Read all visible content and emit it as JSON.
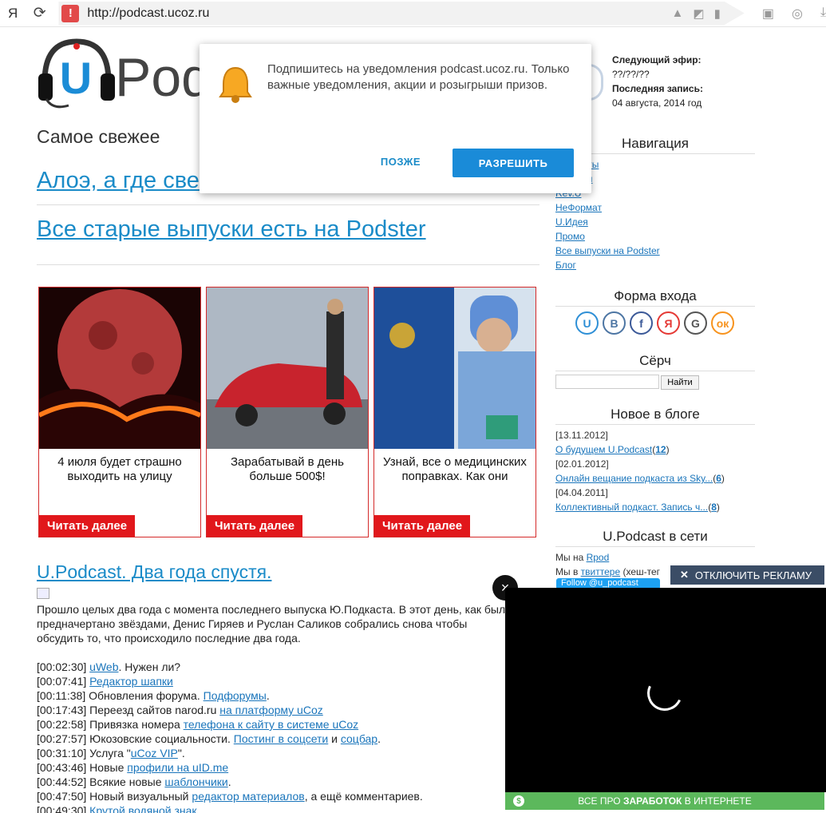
{
  "browser": {
    "logo": "Я",
    "url": "http://podcast.ucoz.ru",
    "warning_icon": "warning-icon",
    "reload_icon": "reload-icon",
    "badge_count": "1"
  },
  "site": {
    "logo_letter": "U",
    "logo_text": "Podc"
  },
  "header_info": {
    "next_label": "Следующий эфир:",
    "next_value": "??/??/??",
    "last_label": "Последняя запись:",
    "last_value": "04 августа, 2014 год"
  },
  "main": {
    "section_title": "Самое свежее",
    "headline1": "Алоэ, а где све",
    "headline2": "Все старые выпуски есть на Podster",
    "cards": [
      {
        "title": "4 июля будет страшно выходить на улицу",
        "button": "Читать далее"
      },
      {
        "title": "Зарабатывай в день больше 500$!",
        "button": "Читать далее"
      },
      {
        "title": "Узнай, все о медицинских поправках. Как они",
        "button": "Читать далее"
      }
    ],
    "post_title": "U.Podcast. Два года спустя.",
    "post_intro": "Прошло целых два года с момента последнего выпуска Ю.Подкаста. В этот день, как было предначертано звёздами, Денис Гиряев и Руслан Саликов собрались снова чтобы обсудить то, что происходило последние два года.",
    "timeline": [
      {
        "time": "[00:02:30]",
        "pre": " ",
        "link": "uWeb",
        "post": ". Нужен ли?"
      },
      {
        "time": "[00:07:41]",
        "pre": " ",
        "link": "Редактор шапки",
        "post": ""
      },
      {
        "time": "[00:11:38]",
        "pre": " Обновления форума. ",
        "link": "Подфорумы",
        "post": "."
      },
      {
        "time": "[00:17:43]",
        "pre": " Переезд сайтов narod.ru ",
        "link": "на платформу uCoz",
        "post": ""
      },
      {
        "time": "[00:22:58]",
        "pre": " Привязка номера ",
        "link": "телефона к сайту в системе uCoz",
        "post": ""
      },
      {
        "time": "[00:27:57]",
        "pre": " Юкозовские социальности. ",
        "link": "Постинг в соцсети",
        "post": " и ",
        "link2": "соцбар",
        "post2": "."
      },
      {
        "time": "[00:31:10]",
        "pre": " Услуга \"",
        "link": "uCoz VIP",
        "post": "\"."
      },
      {
        "time": "[00:43:46]",
        "pre": " Новые ",
        "link": "профили на uID.me",
        "post": ""
      },
      {
        "time": "[00:44:52]",
        "pre": " Всякие новые ",
        "link": "шаблончики",
        "post": "."
      },
      {
        "time": "[00:47:50]",
        "pre": " Новый визуальный ",
        "link": "редактор материалов",
        "post": ", а ещё комментариев."
      },
      {
        "time": "[00:49:30]",
        "pre": " ",
        "link": "Крутой водяной знак",
        "post": ""
      }
    ]
  },
  "sidebar": {
    "nav_title": "Навигация",
    "nav_items": [
      "Подкасты",
      "Новости",
      "Rev.U",
      "НеФормат",
      "U.Идея",
      "Промо",
      "Все выпуски на Podster",
      "Блог"
    ],
    "login_title": "Форма входа",
    "social": [
      {
        "letter": "U",
        "color": "#2e8fd6",
        "icon": "ucoz-icon"
      },
      {
        "letter": "B",
        "color": "#4c75a3",
        "icon": "vk-icon"
      },
      {
        "letter": "f",
        "color": "#3b5998",
        "icon": "facebook-icon"
      },
      {
        "letter": "Я",
        "color": "#e53935",
        "icon": "yandex-icon"
      },
      {
        "letter": "G",
        "color": "#555555",
        "icon": "google-icon"
      },
      {
        "letter": "ок",
        "color": "#f7931e",
        "icon": "odnoklassniki-icon"
      }
    ],
    "search_title": "Сёрч",
    "search_button": "Найти",
    "blog_title": "Новое в блоге",
    "blog_items": [
      {
        "date": "[13.11.2012]",
        "title": "О будущем U.Podcast",
        "count": "12"
      },
      {
        "date": "[02.01.2012]",
        "title": "Онлайн вещание подкаста из Sky...",
        "count": "6"
      },
      {
        "date": "[04.04.2011]",
        "title": "Коллективный подкаст. Запись ч...",
        "count": "8"
      }
    ],
    "net_title": "U.Podcast в сети",
    "net_line1_pre": "Мы на ",
    "net_line1_link": "Rpod",
    "net_line2_pre": "Мы в ",
    "net_line2_link": "твиттере",
    "net_line2_post": " (хеш-тег",
    "follow_label": "Follow @u_podcast"
  },
  "notification": {
    "text": "Подпишитесь на уведомления podcast.ucoz.ru. Только важные уведомления, акции и розыгрыши призов.",
    "later": "ПОЗЖЕ",
    "allow": "РАЗРЕШИТЬ"
  },
  "ad": {
    "close": "×",
    "disable": "ОТКЛЮЧИТЬ РЕКЛАМУ",
    "bottom_pre": "ВСЕ ПРО ",
    "bottom_bold": "ЗАРАБОТОК",
    "bottom_post": " В ИНТЕРНЕТЕ",
    "dollar": "$"
  }
}
